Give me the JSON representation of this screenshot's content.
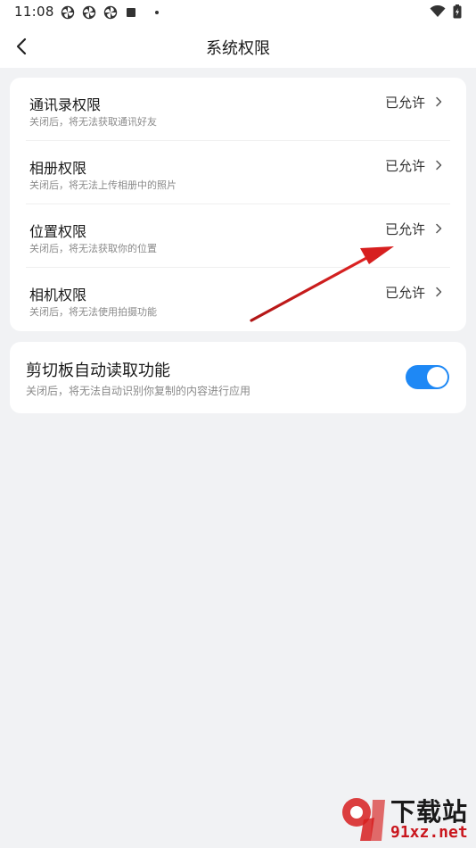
{
  "status_bar": {
    "time": "11:08"
  },
  "header": {
    "title": "系统权限"
  },
  "permissions": [
    {
      "title": "通讯录权限",
      "description": "关闭后，将无法获取通讯好友",
      "status": "已允许"
    },
    {
      "title": "相册权限",
      "description": "关闭后，将无法上传相册中的照片",
      "status": "已允许"
    },
    {
      "title": "位置权限",
      "description": "关闭后，将无法获取你的位置",
      "status": "已允许"
    },
    {
      "title": "相机权限",
      "description": "关闭后，将无法使用拍摄功能",
      "status": "已允许"
    }
  ],
  "clipboard": {
    "title": "剪切板自动读取功能",
    "description": "关闭后，将无法自动识别你复制的内容进行应用",
    "enabled": true
  },
  "watermark": {
    "brand": "下载站",
    "url": "91xz.net"
  },
  "colors": {
    "accent": "#1e88f5",
    "background": "#f1f2f4",
    "annotation": "#d71f1f"
  }
}
